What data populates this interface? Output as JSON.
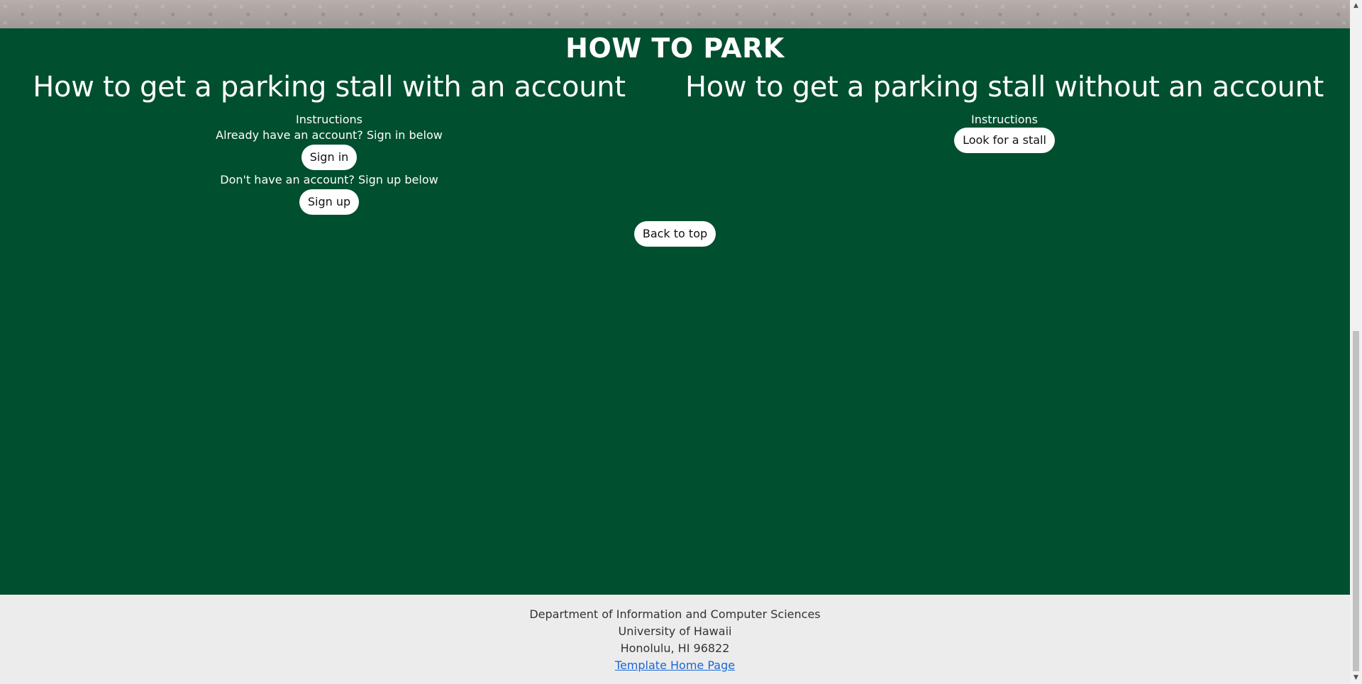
{
  "section": {
    "title": "HOW TO PARK"
  },
  "with_account": {
    "heading": "How to get a parking stall with an account",
    "instructions": "Instructions",
    "signin_prompt": "Already have an account? Sign in below",
    "signin_label": "Sign in",
    "signup_prompt": "Don't have an account? Sign up below",
    "signup_label": "Sign up"
  },
  "without_account": {
    "heading": "How to get a parking stall without an account",
    "instructions": "Instructions",
    "look_label": "Look for a stall"
  },
  "back_to_top_label": "Back to top",
  "footer": {
    "line1": "Department of Information and Computer Sciences",
    "line2": "University of Hawaii",
    "line3": "Honolulu, HI 96822",
    "link": "Template Home Page"
  },
  "colors": {
    "section_bg": "#004f2f",
    "footer_bg": "#ececec",
    "link": "#1a66d9"
  },
  "icons": {
    "scroll_up": "scroll-up-arrow-icon",
    "scroll_down": "scroll-down-arrow-icon"
  }
}
